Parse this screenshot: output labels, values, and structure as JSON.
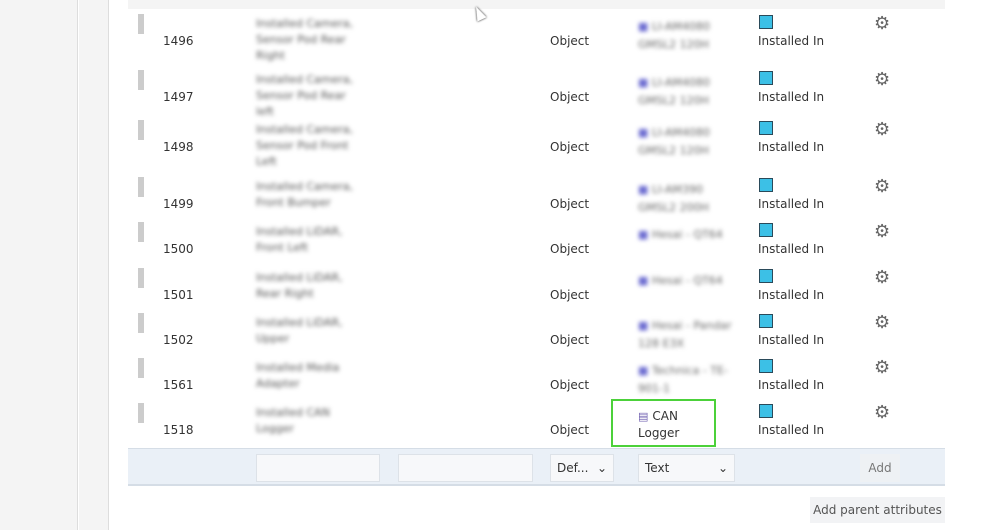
{
  "rows": [
    {
      "id": "1496",
      "name": "Installed Camera, Sensor Pod Rear Right",
      "type": "Object",
      "relation": "LI-AM4080 GMSL2 120H",
      "relation_label": "Installed In"
    },
    {
      "id": "1497",
      "name": "Installed Camera, Sensor Pod Rear left",
      "type": "Object",
      "relation": "LI-AM4080 GMSL2 120H",
      "relation_label": "Installed In"
    },
    {
      "id": "1498",
      "name": "Installed Camera, Sensor Pod Front Left",
      "type": "Object",
      "relation": "LI-AM4080 GMSL2 120H",
      "relation_label": "Installed In"
    },
    {
      "id": "1499",
      "name": "Installed Camera, Front Bumper",
      "type": "Object",
      "relation": "LI-AM390 GMSL2 200H",
      "relation_label": "Installed In"
    },
    {
      "id": "1500",
      "name": "Installed LiDAR, Front Left",
      "type": "Object",
      "relation": "Hesai - QT64",
      "relation_label": "Installed In"
    },
    {
      "id": "1501",
      "name": "Installed LiDAR, Rear Right",
      "type": "Object",
      "relation": "Hesai - QT64",
      "relation_label": "Installed In"
    },
    {
      "id": "1502",
      "name": "Installed LiDAR, Upper",
      "type": "Object",
      "relation": "Hesai - Pandar 128 E3X",
      "relation_label": "Installed In"
    },
    {
      "id": "1561",
      "name": "Installed Media Adapter",
      "type": "Object",
      "relation": "Technica - TE-901-1",
      "relation_label": "Installed In"
    },
    {
      "id": "1518",
      "name": "Installed CAN Logger",
      "type": "Object",
      "relation": "CAN Logger",
      "relation_label": "Installed In"
    }
  ],
  "footer": {
    "type_select": "Def...",
    "datatype_select": "Text",
    "add_label": "Add"
  },
  "add_parent_label": "Add parent attributes",
  "colors": {
    "relation_swatch": "#3cc0e6",
    "highlight": "#4cd13a",
    "footer_bg": "#eaf0f7"
  }
}
